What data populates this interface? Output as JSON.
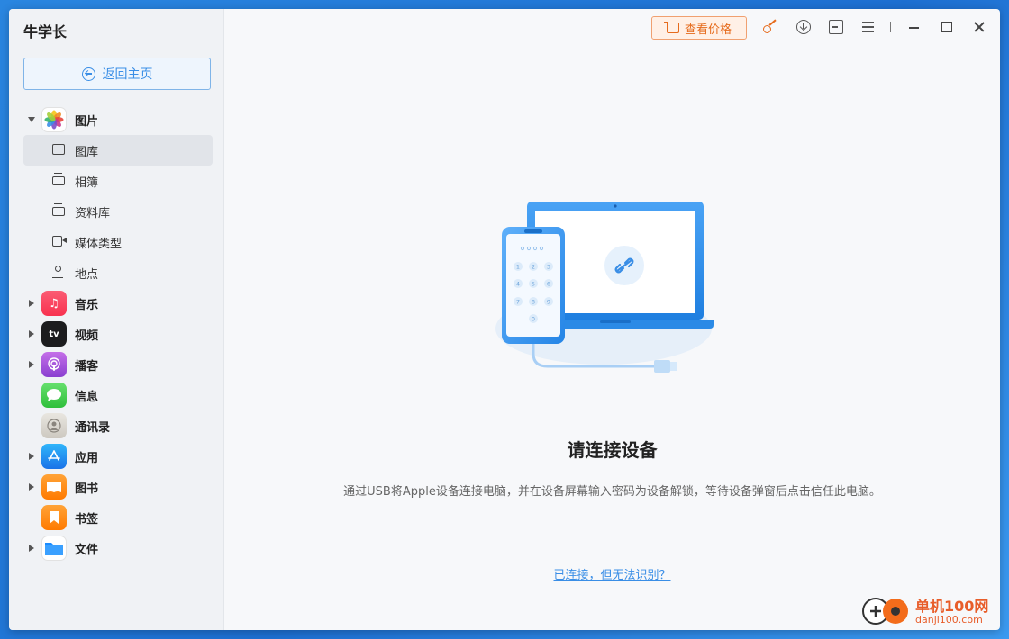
{
  "app": {
    "title": "牛学长"
  },
  "sidebar": {
    "back_label": "返回主页",
    "categories": [
      {
        "label": "图片",
        "icon": "photos-icon",
        "expanded": true
      },
      {
        "label": "音乐",
        "icon": "music-icon"
      },
      {
        "label": "视频",
        "icon": "tv-icon"
      },
      {
        "label": "播客",
        "icon": "podcast-icon"
      },
      {
        "label": "信息",
        "icon": "messages-icon"
      },
      {
        "label": "通讯录",
        "icon": "contacts-icon"
      },
      {
        "label": "应用",
        "icon": "appstore-icon"
      },
      {
        "label": "图书",
        "icon": "books-icon"
      },
      {
        "label": "书签",
        "icon": "bookmark-icon"
      },
      {
        "label": "文件",
        "icon": "files-icon"
      }
    ],
    "photo_items": [
      {
        "label": "图库",
        "active": true
      },
      {
        "label": "相簿"
      },
      {
        "label": "资料库"
      },
      {
        "label": "媒体类型"
      },
      {
        "label": "地点"
      }
    ]
  },
  "toolbar": {
    "price_label": "查看价格"
  },
  "main": {
    "title": "请连接设备",
    "description": "通过USB将Apple设备连接电脑，并在设备屏幕输入密码为设备解锁，等待设备弹窗后点击信任此电脑。",
    "link": "已连接，但无法识别？",
    "keypad": [
      "1",
      "2",
      "3",
      "4",
      "5",
      "6",
      "7",
      "8",
      "9",
      "0"
    ]
  },
  "watermark": {
    "text": "单机100网",
    "sub": "danji100.com"
  },
  "colors": {
    "accent": "#3a8ee6",
    "price": "#e66b1c"
  }
}
